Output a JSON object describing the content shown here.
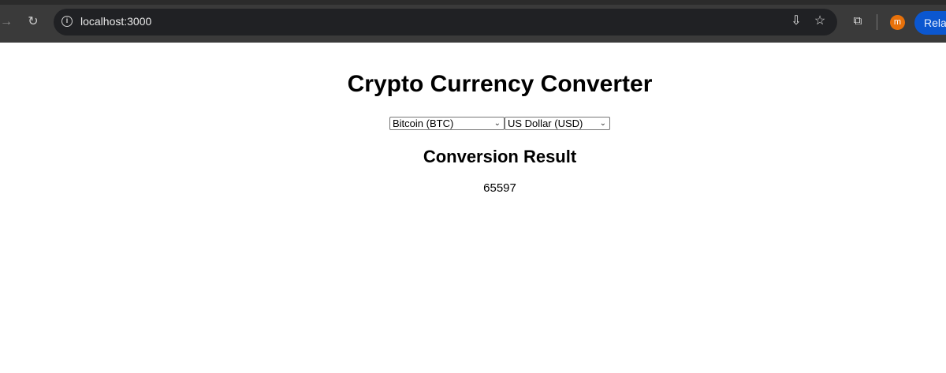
{
  "browser": {
    "url": "localhost:3000",
    "avatar_letter": "m",
    "relaunch_label": "Relau",
    "icons": {
      "forward": "arrow-right-icon",
      "reload": "reload-icon",
      "info": "info-icon",
      "install": "install-app-icon",
      "star": "star-icon",
      "extensions": "puzzle-icon"
    }
  },
  "app": {
    "title": "Crypto Currency Converter",
    "from_select": {
      "selected": "Bitcoin (BTC)"
    },
    "to_select": {
      "selected": "US Dollar (USD)"
    },
    "result_heading": "Conversion Result",
    "result_value": "65597"
  }
}
